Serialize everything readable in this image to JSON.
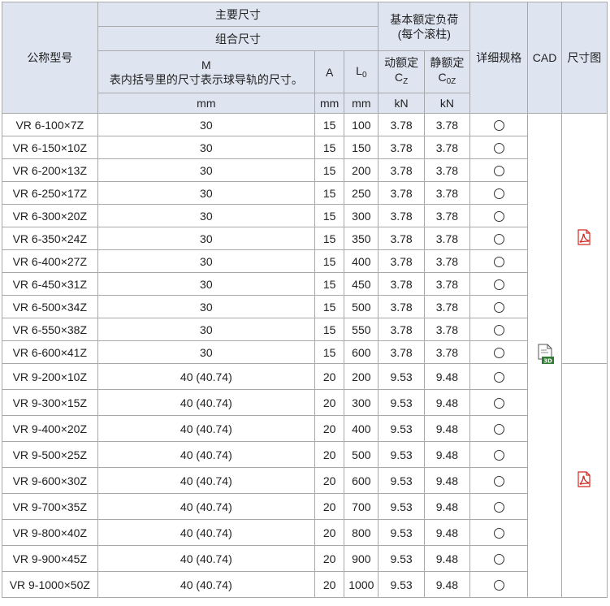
{
  "header": {
    "model": "公称型号",
    "main_dims": "主要尺寸",
    "combo_dims": "组合尺寸",
    "m_title": "M",
    "m_note": "表内括号里的尺寸表示球导轨的尺寸。",
    "a": "A",
    "l0_main": "L",
    "l0_sub": "0",
    "load": "基本额定负荷",
    "load_note": "(每个滚柱)",
    "dyn": "动额定",
    "dyn_sym": "C",
    "dyn_sub": "Z",
    "stat": "静额定",
    "stat_sym": "C",
    "stat_sub": "0Z",
    "detail": "详细规格",
    "cad": "CAD",
    "drawing": "尺寸图",
    "unit_m": "mm",
    "unit_a": "mm",
    "unit_l0": "mm",
    "unit_cz": "kN",
    "unit_c0z": "kN"
  },
  "rows_vr6": [
    {
      "model": "VR 6-100×7Z",
      "m": "30",
      "a": "15",
      "l0": "100",
      "cz": "3.78",
      "c0z": "3.78"
    },
    {
      "model": "VR 6-150×10Z",
      "m": "30",
      "a": "15",
      "l0": "150",
      "cz": "3.78",
      "c0z": "3.78"
    },
    {
      "model": "VR 6-200×13Z",
      "m": "30",
      "a": "15",
      "l0": "200",
      "cz": "3.78",
      "c0z": "3.78"
    },
    {
      "model": "VR 6-250×17Z",
      "m": "30",
      "a": "15",
      "l0": "250",
      "cz": "3.78",
      "c0z": "3.78"
    },
    {
      "model": "VR 6-300×20Z",
      "m": "30",
      "a": "15",
      "l0": "300",
      "cz": "3.78",
      "c0z": "3.78"
    },
    {
      "model": "VR 6-350×24Z",
      "m": "30",
      "a": "15",
      "l0": "350",
      "cz": "3.78",
      "c0z": "3.78"
    },
    {
      "model": "VR 6-400×27Z",
      "m": "30",
      "a": "15",
      "l0": "400",
      "cz": "3.78",
      "c0z": "3.78"
    },
    {
      "model": "VR 6-450×31Z",
      "m": "30",
      "a": "15",
      "l0": "450",
      "cz": "3.78",
      "c0z": "3.78"
    },
    {
      "model": "VR 6-500×34Z",
      "m": "30",
      "a": "15",
      "l0": "500",
      "cz": "3.78",
      "c0z": "3.78"
    },
    {
      "model": "VR 6-550×38Z",
      "m": "30",
      "a": "15",
      "l0": "550",
      "cz": "3.78",
      "c0z": "3.78"
    },
    {
      "model": "VR 6-600×41Z",
      "m": "30",
      "a": "15",
      "l0": "600",
      "cz": "3.78",
      "c0z": "3.78"
    }
  ],
  "rows_vr9": [
    {
      "model": "VR 9-200×10Z",
      "m": "40 (40.74)",
      "a": "20",
      "l0": "200",
      "cz": "9.53",
      "c0z": "9.48"
    },
    {
      "model": "VR 9-300×15Z",
      "m": "40 (40.74)",
      "a": "20",
      "l0": "300",
      "cz": "9.53",
      "c0z": "9.48"
    },
    {
      "model": "VR 9-400×20Z",
      "m": "40 (40.74)",
      "a": "20",
      "l0": "400",
      "cz": "9.53",
      "c0z": "9.48"
    },
    {
      "model": "VR 9-500×25Z",
      "m": "40 (40.74)",
      "a": "20",
      "l0": "500",
      "cz": "9.53",
      "c0z": "9.48"
    },
    {
      "model": "VR 9-600×30Z",
      "m": "40 (40.74)",
      "a": "20",
      "l0": "600",
      "cz": "9.53",
      "c0z": "9.48"
    },
    {
      "model": "VR 9-700×35Z",
      "m": "40 (40.74)",
      "a": "20",
      "l0": "700",
      "cz": "9.53",
      "c0z": "9.48"
    },
    {
      "model": "VR 9-800×40Z",
      "m": "40 (40.74)",
      "a": "20",
      "l0": "800",
      "cz": "9.53",
      "c0z": "9.48"
    },
    {
      "model": "VR 9-900×45Z",
      "m": "40 (40.74)",
      "a": "20",
      "l0": "900",
      "cz": "9.53",
      "c0z": "9.48"
    },
    {
      "model": "VR 9-1000×50Z",
      "m": "40 (40.74)",
      "a": "20",
      "l0": "1000",
      "cz": "9.53",
      "c0z": "9.48"
    }
  ],
  "icons": {
    "detail": "circle-icon",
    "cad": "cad-3d-file-icon",
    "drawing": "pdf-icon",
    "cad_badge": "3D"
  },
  "colors": {
    "header_bg": "#dfe4f1",
    "border": "#a9a9a9",
    "pdf_red": "#d0281f",
    "cad_green": "#2e7d32"
  }
}
